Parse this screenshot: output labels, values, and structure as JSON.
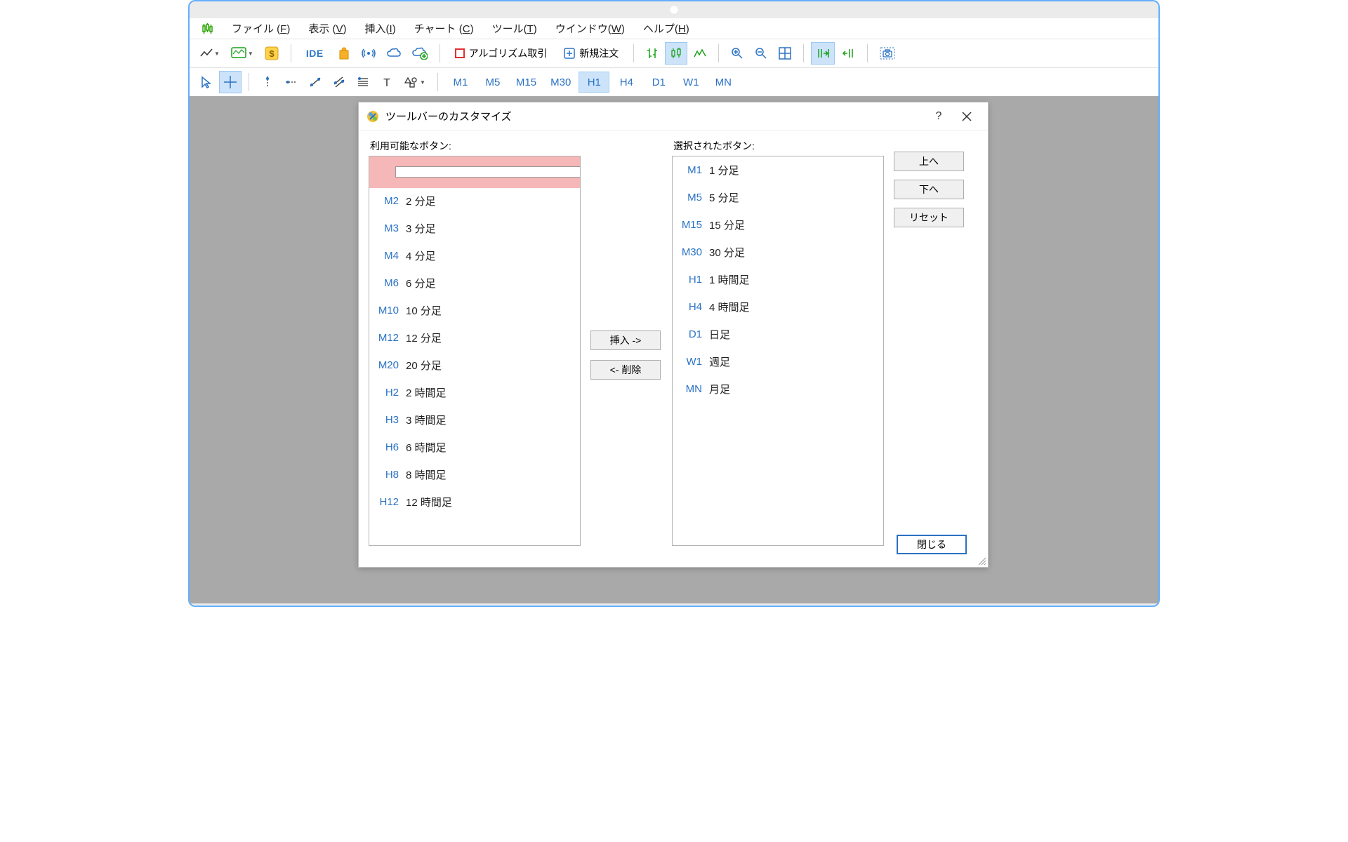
{
  "menubar": {
    "items": [
      "ファイル (F)",
      "表示 (V)",
      "挿入(I)",
      "チャート (C)",
      "ツール(T)",
      "ウインドウ(W)",
      "ヘルプ(H)"
    ],
    "underline_chars": [
      "F",
      "V",
      "I",
      "C",
      "T",
      "W",
      "H"
    ]
  },
  "toolbar1": {
    "ide": "IDE",
    "algo_label": "アルゴリズム取引",
    "new_order": "新規注文"
  },
  "toolbar2": {
    "timeframes": [
      "M1",
      "M5",
      "M15",
      "M30",
      "H1",
      "H4",
      "D1",
      "W1",
      "MN"
    ],
    "active": "H1"
  },
  "dialog": {
    "title": "ツールバーのカスタマイズ",
    "help": "?",
    "available_label": "利用可能なボタン:",
    "selected_label": "選択されたボタン:",
    "insert_btn": "挿入 ->",
    "remove_btn": "<- 削除",
    "up_btn": "上へ",
    "down_btn": "下へ",
    "reset_btn": "リセット",
    "close_btn": "閉じる",
    "available": [
      {
        "code": "M2",
        "desc": "2 分足"
      },
      {
        "code": "M3",
        "desc": "3 分足"
      },
      {
        "code": "M4",
        "desc": "4 分足"
      },
      {
        "code": "M6",
        "desc": "6 分足"
      },
      {
        "code": "M10",
        "desc": "10 分足"
      },
      {
        "code": "M12",
        "desc": "12 分足"
      },
      {
        "code": "M20",
        "desc": "20 分足"
      },
      {
        "code": "H2",
        "desc": "2 時間足"
      },
      {
        "code": "H3",
        "desc": "3 時間足"
      },
      {
        "code": "H6",
        "desc": "6 時間足"
      },
      {
        "code": "H8",
        "desc": "8 時間足"
      },
      {
        "code": "H12",
        "desc": "12 時間足"
      }
    ],
    "selected": [
      {
        "code": "M1",
        "desc": "1 分足"
      },
      {
        "code": "M5",
        "desc": "5 分足"
      },
      {
        "code": "M15",
        "desc": "15 分足"
      },
      {
        "code": "M30",
        "desc": "30 分足"
      },
      {
        "code": "H1",
        "desc": "1 時間足"
      },
      {
        "code": "H4",
        "desc": "4 時間足"
      },
      {
        "code": "D1",
        "desc": "日足"
      },
      {
        "code": "W1",
        "desc": "週足"
      },
      {
        "code": "MN",
        "desc": "月足"
      }
    ]
  }
}
